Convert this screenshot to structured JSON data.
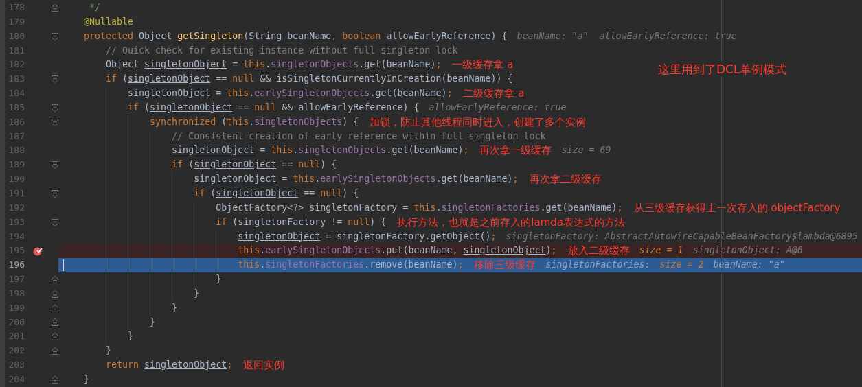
{
  "note": "这里用到了DCL单例模式",
  "lines": [
    {
      "number": "178",
      "fold_start": false,
      "fold_end": true,
      "breakpoint": false,
      "selected": false,
      "tokens": [
        {
          "kind": "doc",
          "text": "     */"
        }
      ]
    },
    {
      "number": "179",
      "fold_start": false,
      "fold_end": false,
      "breakpoint": false,
      "selected": false,
      "tokens": [
        {
          "kind": "annotation",
          "text": "    @Nullable"
        }
      ]
    },
    {
      "number": "180",
      "fold_start": true,
      "fold_end": false,
      "breakpoint": false,
      "selected": false,
      "tokens": [
        {
          "kind": "keyword",
          "text": "    protected"
        },
        {
          "kind": "plain",
          "text": " Object "
        },
        {
          "kind": "method",
          "text": "getSingleton"
        },
        {
          "kind": "plain",
          "text": "(String beanName"
        },
        {
          "kind": "keyword",
          "text": ", boolean"
        },
        {
          "kind": "plain",
          "text": " allowEarlyReference) {"
        }
      ],
      "hints": [
        {
          "kind": "text",
          "text": "beanName: \"a\"  allowEarlyReference: true"
        }
      ]
    },
    {
      "number": "181",
      "fold_start": false,
      "fold_end": false,
      "breakpoint": false,
      "selected": false,
      "tokens": [
        {
          "kind": "comment",
          "text": "        // Quick check for existing instance without full singleton lock"
        }
      ]
    },
    {
      "number": "182",
      "fold_start": false,
      "fold_end": false,
      "breakpoint": false,
      "selected": false,
      "tokens": [
        {
          "kind": "plain",
          "text": "        Object "
        },
        {
          "kind": "variable",
          "text": "singletonObject"
        },
        {
          "kind": "plain",
          "text": " = "
        },
        {
          "kind": "keyword",
          "text": "this"
        },
        {
          "kind": "plain",
          "text": "."
        },
        {
          "kind": "field",
          "text": "singletonObjects"
        },
        {
          "kind": "plain",
          "text": ".get(beanName)"
        },
        {
          "kind": "keyword",
          "text": ";"
        }
      ],
      "note": "一级缓存拿 a"
    },
    {
      "number": "183",
      "fold_start": true,
      "fold_end": false,
      "breakpoint": false,
      "selected": false,
      "tokens": [
        {
          "kind": "keyword",
          "text": "        if"
        },
        {
          "kind": "plain",
          "text": " ("
        },
        {
          "kind": "variable",
          "text": "singletonObject"
        },
        {
          "kind": "plain",
          "text": " == "
        },
        {
          "kind": "keyword",
          "text": "null"
        },
        {
          "kind": "plain",
          "text": " && isSingletonCurrentlyInCreation(beanName)) {"
        }
      ]
    },
    {
      "number": "184",
      "fold_start": false,
      "fold_end": false,
      "breakpoint": false,
      "selected": false,
      "tokens": [
        {
          "kind": "variable",
          "text": "            singletonObject"
        },
        {
          "kind": "plain",
          "text": " = "
        },
        {
          "kind": "keyword",
          "text": "this"
        },
        {
          "kind": "plain",
          "text": "."
        },
        {
          "kind": "field",
          "text": "earlySingletonObjects"
        },
        {
          "kind": "plain",
          "text": ".get(beanName)"
        },
        {
          "kind": "keyword",
          "text": ";"
        }
      ],
      "note": "二级缓存拿 a"
    },
    {
      "number": "185",
      "fold_start": true,
      "fold_end": false,
      "breakpoint": false,
      "selected": false,
      "tokens": [
        {
          "kind": "keyword",
          "text": "            if"
        },
        {
          "kind": "plain",
          "text": " ("
        },
        {
          "kind": "variable",
          "text": "singletonObject"
        },
        {
          "kind": "plain",
          "text": " == "
        },
        {
          "kind": "keyword",
          "text": "null"
        },
        {
          "kind": "plain",
          "text": " && allowEarlyReference) {"
        }
      ],
      "hints": [
        {
          "kind": "text",
          "text": "allowEarlyReference: true"
        }
      ]
    },
    {
      "number": "186",
      "fold_start": true,
      "fold_end": false,
      "breakpoint": false,
      "selected": false,
      "tokens": [
        {
          "kind": "keyword",
          "text": "                synchronized"
        },
        {
          "kind": "plain",
          "text": " ("
        },
        {
          "kind": "keyword",
          "text": "this"
        },
        {
          "kind": "plain",
          "text": "."
        },
        {
          "kind": "field",
          "text": "singletonObjects"
        },
        {
          "kind": "plain",
          "text": ") {"
        }
      ],
      "note": "加锁，防止其他线程同时进入，创建了多个实例"
    },
    {
      "number": "187",
      "fold_start": false,
      "fold_end": false,
      "breakpoint": false,
      "selected": false,
      "tokens": [
        {
          "kind": "comment",
          "text": "                    // Consistent creation of early reference within full singleton lock"
        }
      ]
    },
    {
      "number": "188",
      "fold_start": false,
      "fold_end": false,
      "breakpoint": false,
      "selected": false,
      "tokens": [
        {
          "kind": "variable",
          "text": "                    singletonObject"
        },
        {
          "kind": "plain",
          "text": " = "
        },
        {
          "kind": "keyword",
          "text": "this"
        },
        {
          "kind": "plain",
          "text": "."
        },
        {
          "kind": "field",
          "text": "singletonObjects"
        },
        {
          "kind": "plain",
          "text": ".get(beanName)"
        },
        {
          "kind": "keyword",
          "text": ";"
        }
      ],
      "note": "再次拿一级缓存",
      "hints": [
        {
          "kind": "text",
          "text": "size = 69"
        }
      ]
    },
    {
      "number": "189",
      "fold_start": true,
      "fold_end": false,
      "breakpoint": false,
      "selected": false,
      "tokens": [
        {
          "kind": "keyword",
          "text": "                    if"
        },
        {
          "kind": "plain",
          "text": " ("
        },
        {
          "kind": "variable",
          "text": "singletonObject"
        },
        {
          "kind": "plain",
          "text": " == "
        },
        {
          "kind": "keyword",
          "text": "null"
        },
        {
          "kind": "plain",
          "text": ") {"
        }
      ]
    },
    {
      "number": "190",
      "fold_start": false,
      "fold_end": false,
      "breakpoint": false,
      "selected": false,
      "tokens": [
        {
          "kind": "variable",
          "text": "                        singletonObject"
        },
        {
          "kind": "plain",
          "text": " = "
        },
        {
          "kind": "keyword",
          "text": "this"
        },
        {
          "kind": "plain",
          "text": "."
        },
        {
          "kind": "field",
          "text": "earlySingletonObjects"
        },
        {
          "kind": "plain",
          "text": ".get(beanName)"
        },
        {
          "kind": "keyword",
          "text": ";"
        }
      ],
      "note": "再次拿二级缓存"
    },
    {
      "number": "191",
      "fold_start": true,
      "fold_end": false,
      "breakpoint": false,
      "selected": false,
      "tokens": [
        {
          "kind": "keyword",
          "text": "                        if"
        },
        {
          "kind": "plain",
          "text": " ("
        },
        {
          "kind": "variable",
          "text": "singletonObject"
        },
        {
          "kind": "plain",
          "text": " == "
        },
        {
          "kind": "keyword",
          "text": "null"
        },
        {
          "kind": "plain",
          "text": ") {"
        }
      ]
    },
    {
      "number": "192",
      "fold_start": false,
      "fold_end": false,
      "breakpoint": false,
      "selected": false,
      "tokens": [
        {
          "kind": "plain",
          "text": "                            ObjectFactory<?> singletonFactory = "
        },
        {
          "kind": "keyword",
          "text": "this"
        },
        {
          "kind": "plain",
          "text": "."
        },
        {
          "kind": "field",
          "text": "singletonFactories"
        },
        {
          "kind": "plain",
          "text": ".get(beanName)"
        },
        {
          "kind": "keyword",
          "text": ";"
        }
      ],
      "note": "从三级缓存获得上一次存入的 objectFactory"
    },
    {
      "number": "193",
      "fold_start": true,
      "fold_end": false,
      "breakpoint": false,
      "selected": false,
      "tokens": [
        {
          "kind": "keyword",
          "text": "                            if"
        },
        {
          "kind": "plain",
          "text": " (singletonFactory != "
        },
        {
          "kind": "keyword",
          "text": "null"
        },
        {
          "kind": "plain",
          "text": ") {"
        }
      ],
      "note": "执行方法，也就是之前存入的lamda表达式的方法"
    },
    {
      "number": "194",
      "fold_start": false,
      "fold_end": false,
      "breakpoint": false,
      "selected": false,
      "tokens": [
        {
          "kind": "variable",
          "text": "                                singletonObject"
        },
        {
          "kind": "plain",
          "text": " = singletonFactory.getObject()"
        },
        {
          "kind": "keyword",
          "text": ";"
        }
      ],
      "hints": [
        {
          "kind": "text",
          "text": "singletonFactory: AbstractAutowireCapableBeanFactory$lambda@6895"
        }
      ]
    },
    {
      "number": "195",
      "fold_start": false,
      "fold_end": false,
      "breakpoint": true,
      "selected": false,
      "tokens": [
        {
          "kind": "keyword",
          "text": "                                this"
        },
        {
          "kind": "plain",
          "text": "."
        },
        {
          "kind": "field",
          "text": "earlySingletonObjects"
        },
        {
          "kind": "plain",
          "text": ".put(beanName"
        },
        {
          "kind": "keyword",
          "text": ", "
        },
        {
          "kind": "variable",
          "text": "singletonObject"
        },
        {
          "kind": "plain",
          "text": ")"
        },
        {
          "kind": "keyword",
          "text": ";"
        }
      ],
      "note": "放入二级缓存",
      "hints": [
        {
          "kind": "number",
          "text": "size = 1"
        },
        {
          "kind": "text",
          "text": "singletonObject: A@6"
        }
      ]
    },
    {
      "number": "196",
      "fold_start": false,
      "fold_end": false,
      "breakpoint": false,
      "selected": true,
      "tokens": [
        {
          "kind": "keyword",
          "text": "                                this"
        },
        {
          "kind": "plain",
          "text": "."
        },
        {
          "kind": "field",
          "text": "singletonFactories"
        },
        {
          "kind": "plain",
          "text": ".remove(beanName)"
        },
        {
          "kind": "keyword",
          "text": ";"
        }
      ],
      "note": "移除三级缓存",
      "hints": [
        {
          "kind": "text",
          "text": "singletonFactories:"
        },
        {
          "kind": "number",
          "text": "size = 2"
        },
        {
          "kind": "text",
          "text": "beanName: \"a\""
        }
      ]
    },
    {
      "number": "197",
      "fold_start": false,
      "fold_end": true,
      "breakpoint": false,
      "selected": false,
      "tokens": [
        {
          "kind": "plain",
          "text": "                            }"
        }
      ]
    },
    {
      "number": "198",
      "fold_start": false,
      "fold_end": true,
      "breakpoint": false,
      "selected": false,
      "tokens": [
        {
          "kind": "plain",
          "text": "                        }"
        }
      ]
    },
    {
      "number": "199",
      "fold_start": false,
      "fold_end": true,
      "breakpoint": false,
      "selected": false,
      "tokens": [
        {
          "kind": "plain",
          "text": "                    }"
        }
      ]
    },
    {
      "number": "200",
      "fold_start": false,
      "fold_end": true,
      "breakpoint": false,
      "selected": false,
      "tokens": [
        {
          "kind": "plain",
          "text": "                }"
        }
      ]
    },
    {
      "number": "201",
      "fold_start": false,
      "fold_end": true,
      "breakpoint": false,
      "selected": false,
      "tokens": [
        {
          "kind": "plain",
          "text": "            }"
        }
      ]
    },
    {
      "number": "202",
      "fold_start": false,
      "fold_end": true,
      "breakpoint": false,
      "selected": false,
      "tokens": [
        {
          "kind": "plain",
          "text": "        }"
        }
      ]
    },
    {
      "number": "203",
      "fold_start": false,
      "fold_end": false,
      "breakpoint": false,
      "selected": false,
      "tokens": [
        {
          "kind": "keyword",
          "text": "        return "
        },
        {
          "kind": "variable",
          "text": "singletonObject"
        },
        {
          "kind": "keyword",
          "text": ";"
        }
      ],
      "note": "返回实例"
    },
    {
      "number": "204",
      "fold_start": false,
      "fold_end": true,
      "breakpoint": false,
      "selected": false,
      "tokens": [
        {
          "kind": "plain",
          "text": "    }"
        }
      ]
    }
  ]
}
